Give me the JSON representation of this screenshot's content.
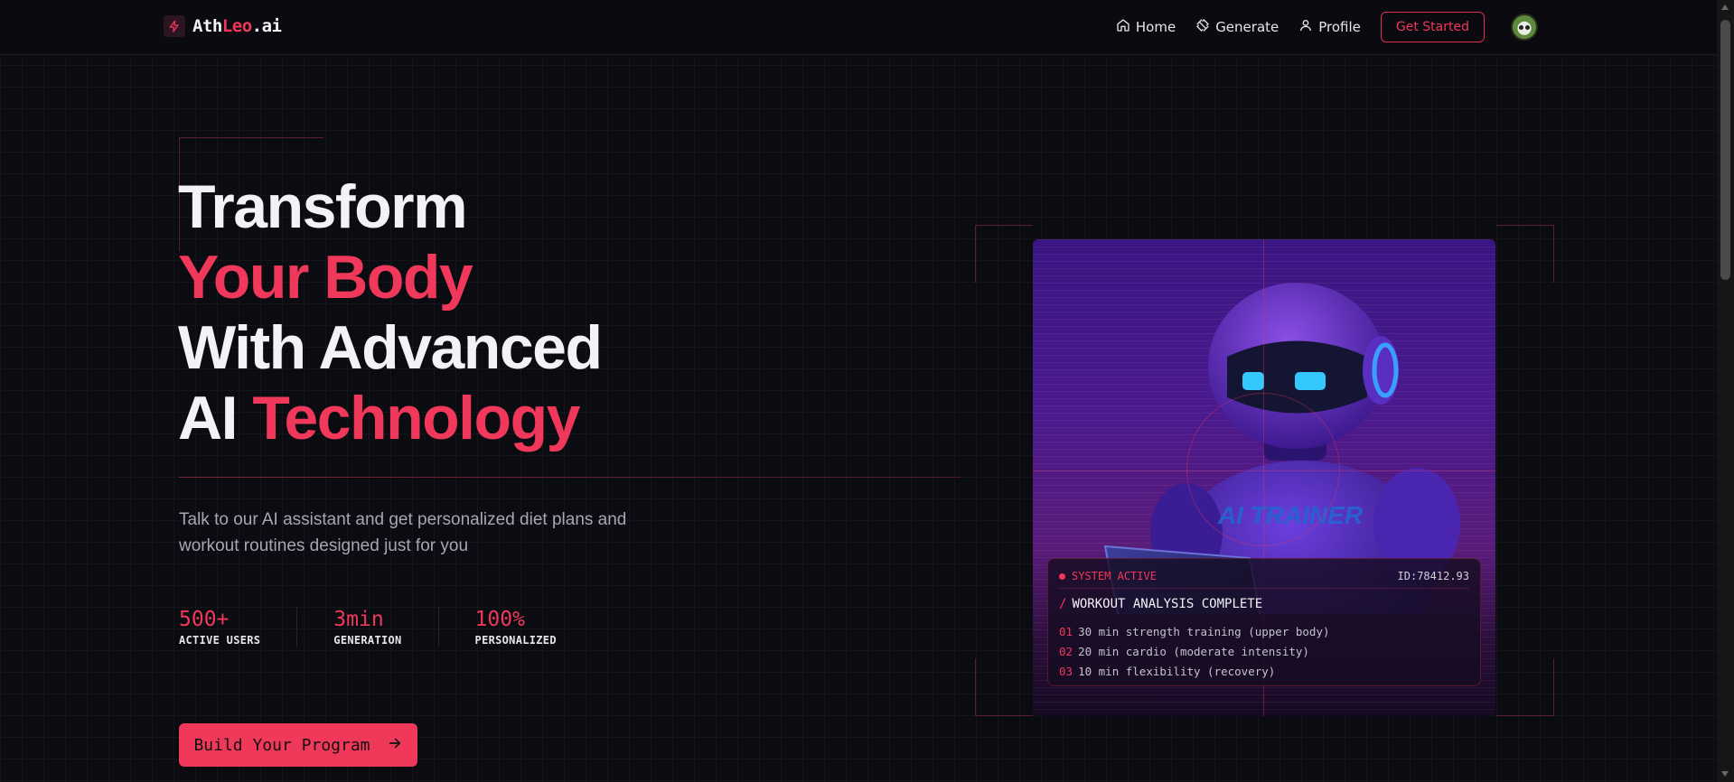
{
  "navbar": {
    "logo": {
      "part1": "Ath",
      "part2": "Leo",
      "part3": ".ai"
    },
    "links": [
      {
        "label": "Home",
        "icon": "home-icon"
      },
      {
        "label": "Generate",
        "icon": "dumbbell-icon"
      },
      {
        "label": "Profile",
        "icon": "user-icon"
      }
    ],
    "cta_label": "Get Started"
  },
  "hero": {
    "headline": {
      "line1": "Transform",
      "line2": "Your Body",
      "line3": "With Advanced",
      "line4_white": "AI ",
      "line4_accent": "Technology"
    },
    "subtext": "Talk to our AI assistant and get personalized diet plans and workout routines designed just for you",
    "stats": [
      {
        "value": "500+",
        "label": "ACTIVE USERS"
      },
      {
        "value": "3min",
        "label": "GENERATION"
      },
      {
        "value": "100%",
        "label": "PERSONALIZED"
      }
    ],
    "cta_label": "Build Your Program"
  },
  "card": {
    "robot_chest_text": "AI TRAINER",
    "status": "SYSTEM ACTIVE",
    "id": "ID:78412.93",
    "title": "WORKOUT ANALYSIS COMPLETE",
    "routine": [
      {
        "num": "01",
        "text": "30 min strength training (upper body)"
      },
      {
        "num": "02",
        "text": "20 min cardio (moderate intensity)"
      },
      {
        "num": "03",
        "text": "10 min flexibility (recovery)"
      }
    ]
  },
  "colors": {
    "accent": "#f0385a",
    "background": "#0b0b12",
    "card_purple": "#4a1a8e"
  }
}
